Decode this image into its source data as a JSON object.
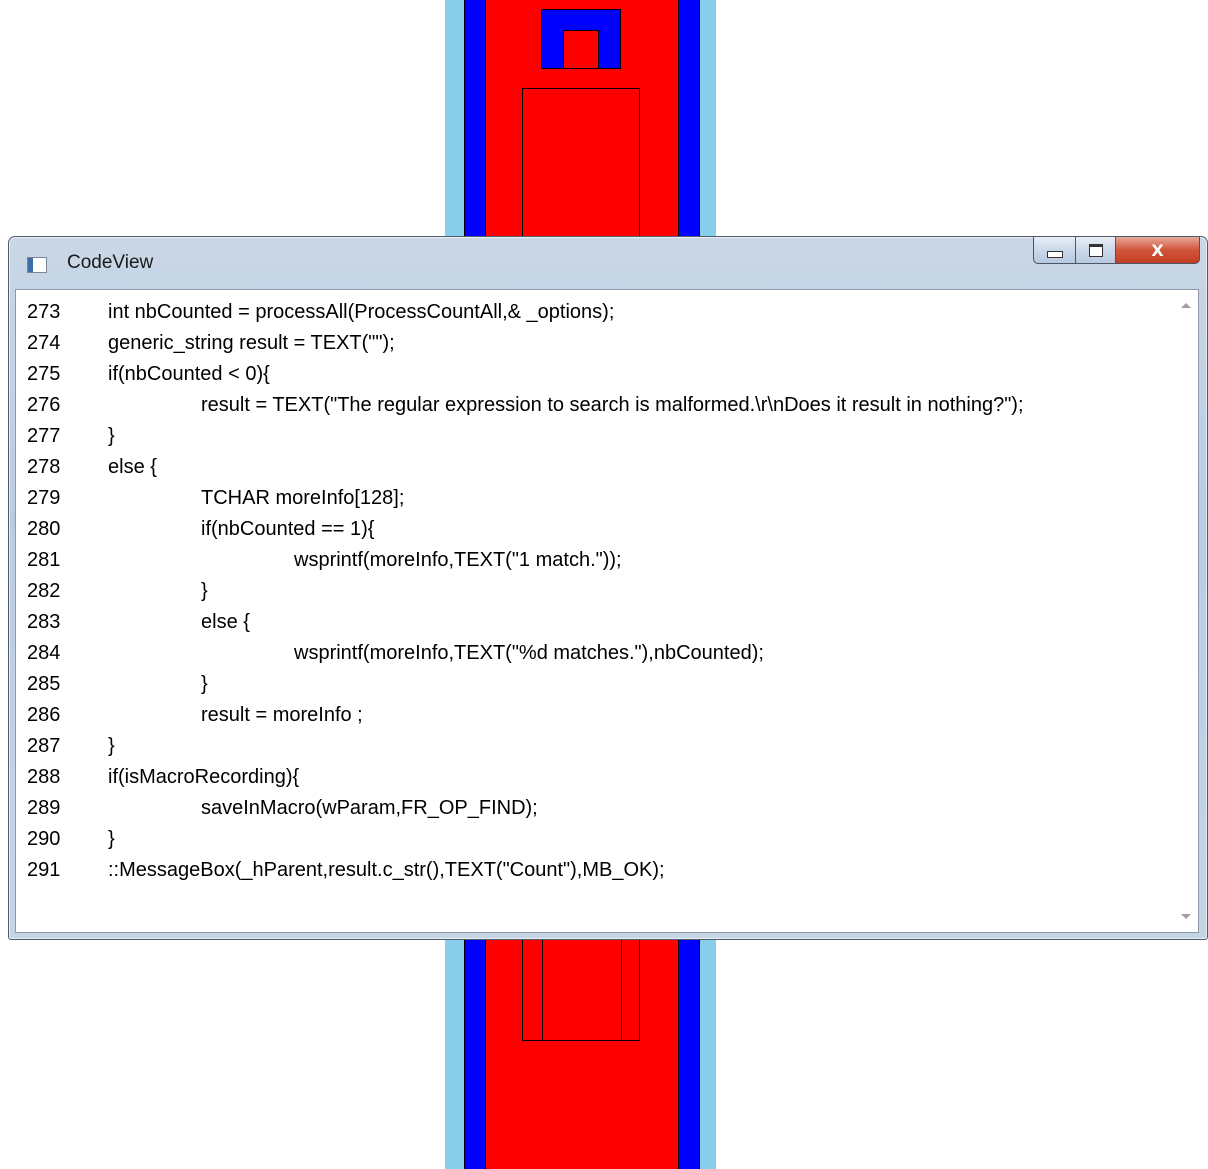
{
  "window": {
    "title": "CodeView",
    "close_label": "X"
  },
  "code_lines": [
    {
      "n": "273",
      "indent": 0,
      "text": "int nbCounted = processAll(ProcessCountAll,& _options);"
    },
    {
      "n": "274",
      "indent": 0,
      "text": "generic_string result = TEXT(\"\");"
    },
    {
      "n": "275",
      "indent": 0,
      "text": "if(nbCounted < 0){"
    },
    {
      "n": "276",
      "indent": 1,
      "text": "result = TEXT(\"The regular expression to search is malformed.\\r\\nDoes it result in nothing?\");"
    },
    {
      "n": "277",
      "indent": 0,
      "text": "}"
    },
    {
      "n": "278",
      "indent": 0,
      "text": "else {"
    },
    {
      "n": "279",
      "indent": 1,
      "text": "TCHAR moreInfo[128];"
    },
    {
      "n": "280",
      "indent": 1,
      "text": "if(nbCounted == 1){"
    },
    {
      "n": "281",
      "indent": 2,
      "text": "wsprintf(moreInfo,TEXT(\"1 match.\"));"
    },
    {
      "n": "282",
      "indent": 1,
      "text": "}"
    },
    {
      "n": "283",
      "indent": 1,
      "text": "else {"
    },
    {
      "n": "284",
      "indent": 2,
      "text": "wsprintf(moreInfo,TEXT(\"%d matches.\"),nbCounted);"
    },
    {
      "n": "285",
      "indent": 1,
      "text": "}"
    },
    {
      "n": "286",
      "indent": 1,
      "text": "result = moreInfo ;"
    },
    {
      "n": "287",
      "indent": 0,
      "text": "}"
    },
    {
      "n": "288",
      "indent": 0,
      "text": "if(isMacroRecording){"
    },
    {
      "n": "289",
      "indent": 1,
      "text": "saveInMacro(wParam,FR_OP_FIND);"
    },
    {
      "n": "290",
      "indent": 0,
      "text": "}"
    },
    {
      "n": "291",
      "indent": 0,
      "text": "::MessageBox(_hParent,result.c_str(),TEXT(\"Count\"),MB_OK);"
    }
  ],
  "colors": {
    "background_red": "#ff0000",
    "background_blue": "#0000ff",
    "background_skyblue": "#87ceeb"
  }
}
